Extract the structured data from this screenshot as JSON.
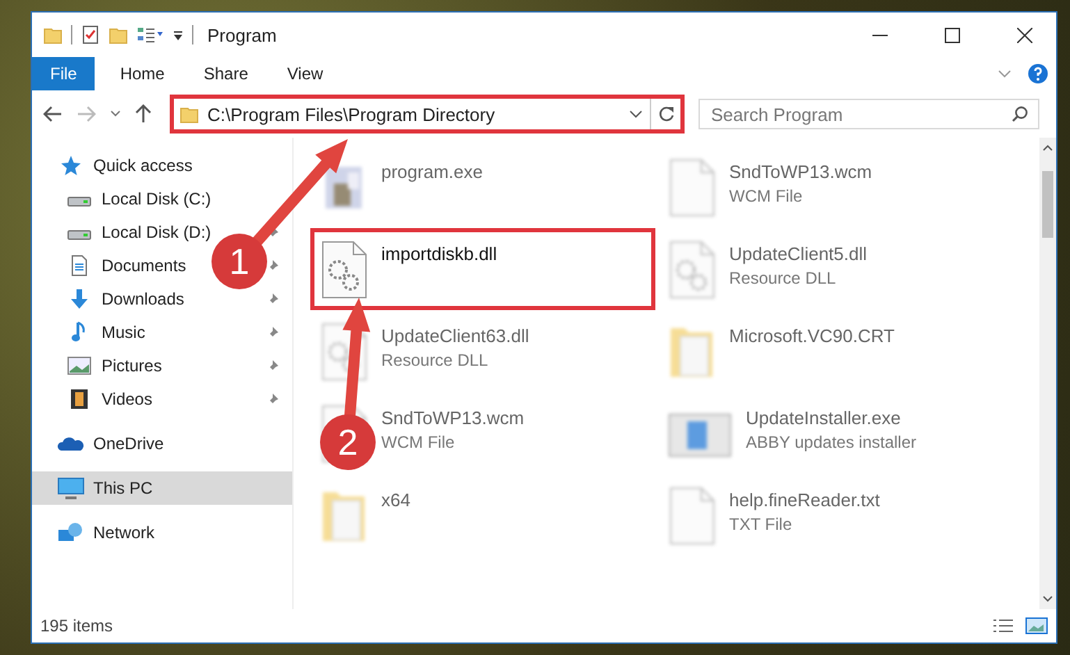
{
  "window": {
    "title": "Program"
  },
  "ribbon_tabs": [
    {
      "label": "File",
      "kind": "file-menu"
    },
    {
      "label": "Home",
      "kind": "tab"
    },
    {
      "label": "Share",
      "kind": "tab"
    },
    {
      "label": "View",
      "kind": "tab"
    }
  ],
  "address_bar": {
    "path": "C:\\Program Files\\Program Directory",
    "highlighted": true
  },
  "search": {
    "placeholder": "Search Program"
  },
  "nav_items": [
    {
      "label": "Quick access",
      "kind": "star",
      "selected": false,
      "pinned": false,
      "children": [
        {
          "label": "Local Disk (C:)",
          "kind": "drive",
          "selected": false,
          "pinned": false
        },
        {
          "label": "Local Disk (D:)",
          "kind": "drive",
          "selected": false,
          "pinned": true
        },
        {
          "label": "Documents",
          "kind": "documents",
          "selected": false,
          "pinned": true
        },
        {
          "label": "Downloads",
          "kind": "downloads",
          "selected": false,
          "pinned": true
        },
        {
          "label": "Music",
          "kind": "music",
          "selected": false,
          "pinned": true
        },
        {
          "label": "Pictures",
          "kind": "pictures",
          "selected": false,
          "pinned": true
        },
        {
          "label": "Videos",
          "kind": "videos",
          "selected": false,
          "pinned": true
        }
      ]
    },
    {
      "label": "OneDrive",
      "kind": "cloud",
      "selected": false,
      "pinned": false
    },
    {
      "label": "This PC",
      "kind": "pc",
      "selected": true,
      "pinned": false
    },
    {
      "label": "Network",
      "kind": "network",
      "selected": false,
      "pinned": false
    }
  ],
  "files": [
    {
      "name": "program.exe",
      "kind": "exe",
      "blurred": true,
      "highlighted": false
    },
    {
      "name": "SndToWP13.wcm",
      "type": "WCM File",
      "kind": "file",
      "blurred": true,
      "highlighted": false
    },
    {
      "name": "importdiskb.dll",
      "kind": "dll",
      "blurred": false,
      "highlighted": true
    },
    {
      "name": "UpdateClient5.dll",
      "type": "Resource DLL",
      "kind": "dll",
      "blurred": true,
      "highlighted": false
    },
    {
      "name": "UpdateClient63.dll",
      "type": "Resource DLL",
      "kind": "dll",
      "blurred": true,
      "highlighted": false
    },
    {
      "name": "Microsoft.VC90.CRT",
      "kind": "folder",
      "blurred": true,
      "highlighted": false
    },
    {
      "name": "SndToWP13.wcm",
      "type": "WCM File",
      "kind": "file",
      "blurred": true,
      "highlighted": false
    },
    {
      "name": "UpdateInstaller.exe",
      "type": "ABBY updates installer",
      "kind": "installer",
      "blurred": true,
      "highlighted": false
    },
    {
      "name": "x64",
      "kind": "folder",
      "blurred": true,
      "highlighted": false
    },
    {
      "name": "help.fineReader.txt",
      "type": "TXT File",
      "kind": "file",
      "blurred": true,
      "highlighted": false
    }
  ],
  "status_bar": {
    "item_count": "195 items"
  },
  "callouts": [
    {
      "number": "1"
    },
    {
      "number": "2"
    }
  ]
}
